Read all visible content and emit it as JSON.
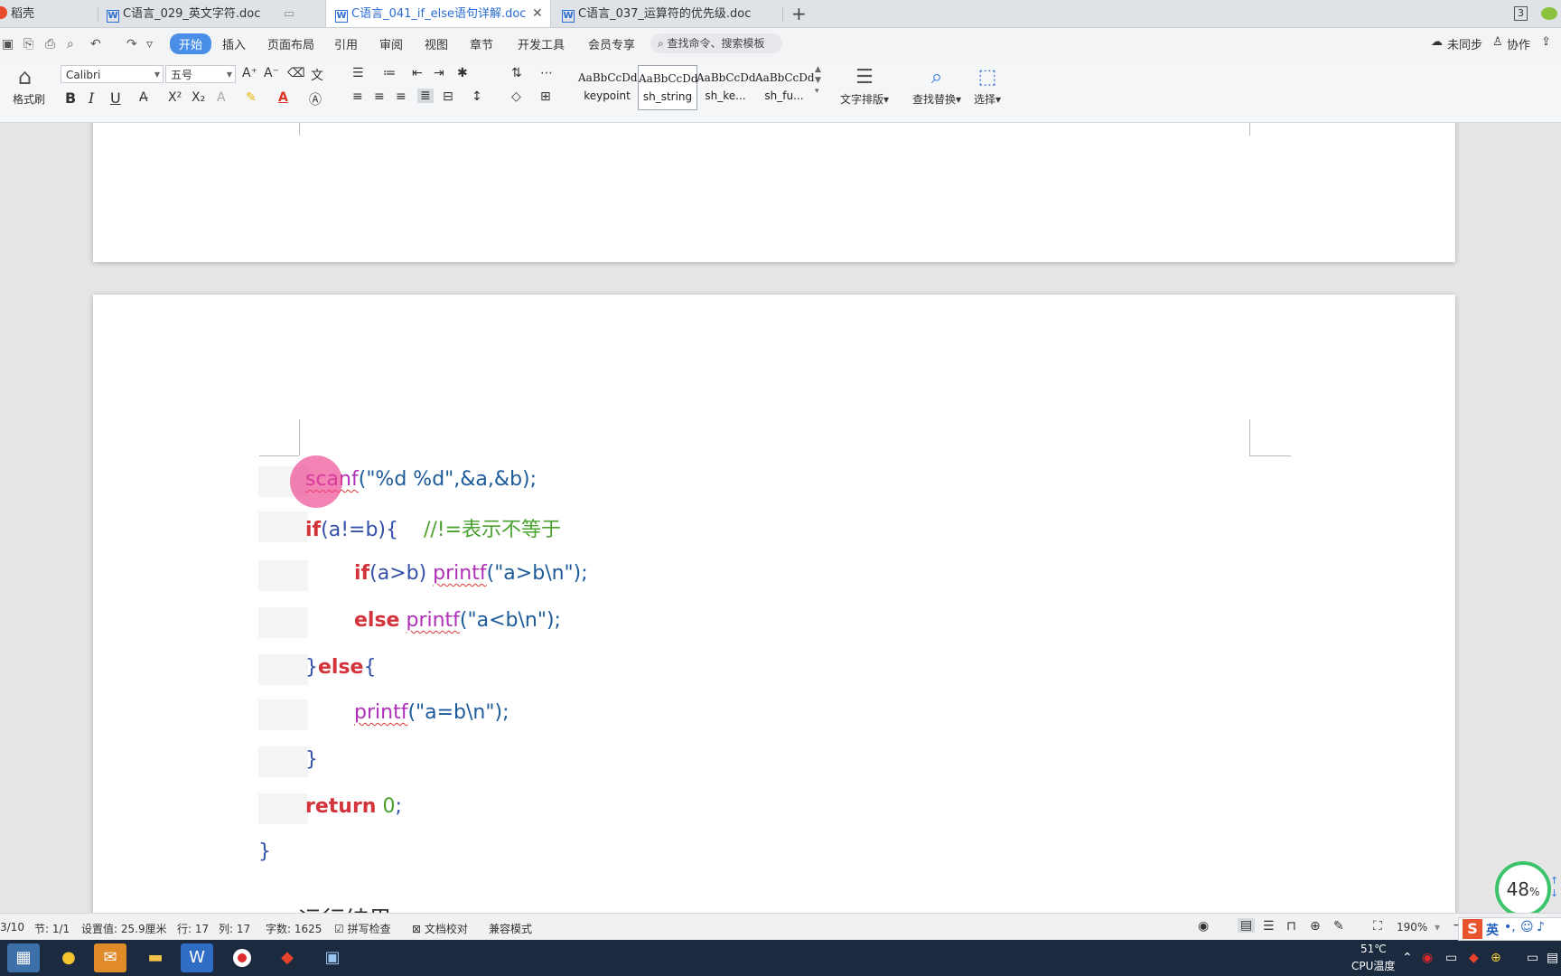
{
  "tabs": [
    {
      "label": "稻壳"
    },
    {
      "label": "C语言_029_英文字符.doc"
    },
    {
      "label": "C语言_041_if_else语句详解.doc",
      "active": true
    },
    {
      "label": "C语言_037_运算符的优先级.doc"
    }
  ],
  "tabbar": {
    "add_label": "+",
    "badge": "3"
  },
  "menu": {
    "items": [
      "开始",
      "插入",
      "页面布局",
      "引用",
      "审阅",
      "视图",
      "章节",
      "开发工具",
      "会员专享"
    ],
    "search_label": "查找命令、搜索模板",
    "sync_label": "未同步",
    "collab_label": "协作"
  },
  "ribbon": {
    "format_painter": "格式刷",
    "font_name": "Calibri",
    "font_size": "五号",
    "bold": "B",
    "italic": "I",
    "underline": "U",
    "styles": [
      {
        "preview": "AaBbCcDd",
        "name": "keypoint"
      },
      {
        "preview": "AaBbCcDd",
        "name": "sh_string"
      },
      {
        "preview": "AaBbCcDd",
        "name": "sh_ke..."
      },
      {
        "preview": "AaBbCcDd",
        "name": "sh_fu..."
      }
    ],
    "text_layout": "文字排版",
    "find_replace": "查找替换",
    "select": "选择"
  },
  "code": {
    "line1_fn": "scanf",
    "line1_args": "(\"%d %d\",&a,&b);",
    "line2_kw": "if",
    "line2_rest": "(a!=b){",
    "line2_comment": "//!=表示不等于",
    "line3_kw": "if",
    "line3_cond": "(a>b) ",
    "line3_fn": "printf",
    "line3_args": "(\"a>b\\n\");",
    "line4_kw": "else",
    "line4_fn": "printf",
    "line4_args": "(\"a<b\\n\");",
    "line5_open": "}",
    "line5_kw": "else",
    "line5_close": "{",
    "line6_fn": "printf",
    "line6_args": "(\"a=b\\n\");",
    "line7": "}",
    "line8_kw": "return",
    "line8_num": "0",
    "line8_semi": ";",
    "line9": "}",
    "next_heading": "运行结果"
  },
  "progress": {
    "value": "48",
    "unit": "%"
  },
  "status": {
    "page": "3/10",
    "section": "节: 1/1",
    "setting": "设置值: 25.9厘米",
    "row": "行: 17",
    "col": "列: 17",
    "wordcount": "字数: 1625",
    "spellcheck": "拼写检查",
    "proof": "文档校对",
    "compat": "兼容模式",
    "zoom": "190%"
  },
  "taskbar": {
    "temp": "51℃",
    "temp_label": "CPU温度",
    "ime": "英"
  }
}
